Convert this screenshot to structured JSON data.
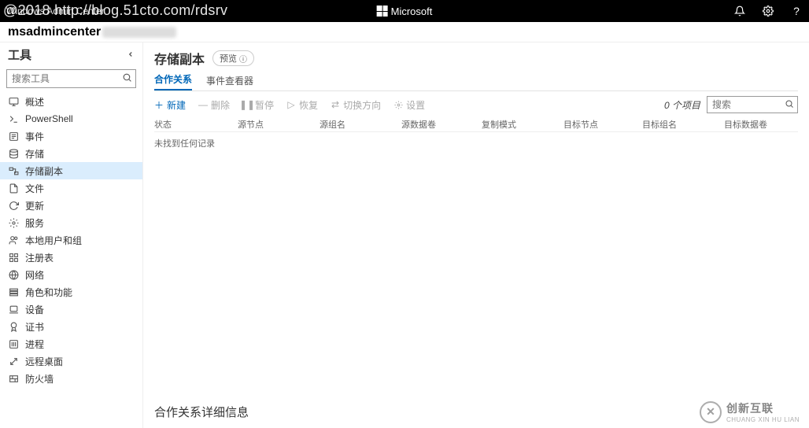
{
  "topbar": {
    "app_name": "Windows Admin Center",
    "brand": "Microsoft",
    "watermark": "@2018 http://blog.51cto.com/rdsrv"
  },
  "hostbar": {
    "hostname": "msadmincenter"
  },
  "sidebar": {
    "title": "工具",
    "search_placeholder": "搜索工具",
    "items": [
      {
        "label": "概述",
        "icon": "monitor-icon"
      },
      {
        "label": "PowerShell",
        "icon": "terminal-icon"
      },
      {
        "label": "事件",
        "icon": "list-icon"
      },
      {
        "label": "存储",
        "icon": "storage-icon"
      },
      {
        "label": "存储副本",
        "icon": "replica-icon",
        "selected": true
      },
      {
        "label": "文件",
        "icon": "file-icon"
      },
      {
        "label": "更新",
        "icon": "update-icon"
      },
      {
        "label": "服务",
        "icon": "gear-icon"
      },
      {
        "label": "本地用户和组",
        "icon": "users-icon"
      },
      {
        "label": "注册表",
        "icon": "registry-icon"
      },
      {
        "label": "网络",
        "icon": "network-icon"
      },
      {
        "label": "角色和功能",
        "icon": "roles-icon"
      },
      {
        "label": "设备",
        "icon": "device-icon"
      },
      {
        "label": "证书",
        "icon": "cert-icon"
      },
      {
        "label": "进程",
        "icon": "process-icon"
      },
      {
        "label": "远程桌面",
        "icon": "remote-icon"
      },
      {
        "label": "防火墙",
        "icon": "firewall-icon"
      }
    ]
  },
  "main": {
    "title": "存储副本",
    "preview_label": "预览",
    "tabs": [
      {
        "label": "合作关系",
        "active": true
      },
      {
        "label": "事件查看器",
        "active": false
      }
    ],
    "toolbar": {
      "new": "新建",
      "delete": "删除",
      "pause": "暂停",
      "resume": "恢复",
      "switch": "切换方向",
      "settings": "设置"
    },
    "count_label": "0 个项目",
    "search_placeholder": "搜索",
    "columns": {
      "status": "状态",
      "src_node": "源节点",
      "src_group": "源组名",
      "src_vol": "源数据卷",
      "mode": "复制模式",
      "dst_node": "目标节点",
      "dst_group": "目标组名",
      "dst_vol": "目标数据卷"
    },
    "empty_text": "未找到任何记录",
    "detail_title": "合作关系详细信息"
  },
  "footer_logo": {
    "text1": "创新互联",
    "text2": "CHUANG XIN HU LIAN"
  }
}
